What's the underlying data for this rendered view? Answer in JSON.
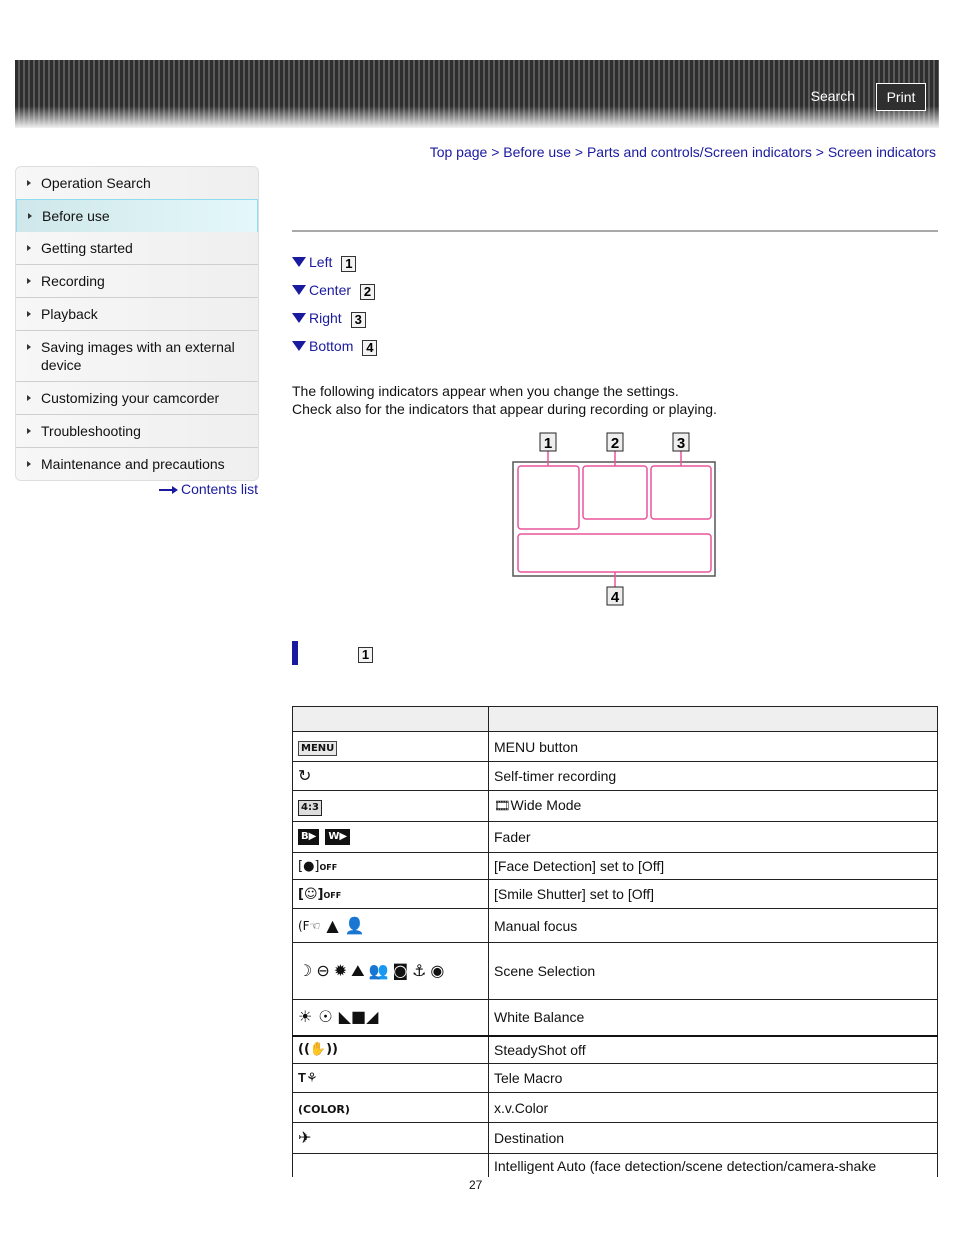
{
  "header": {
    "search_label": "Search",
    "print_label": "Print"
  },
  "sidebar": {
    "items": [
      {
        "label": "Operation Search",
        "active": false
      },
      {
        "label": "Before use",
        "active": true
      },
      {
        "label": "Getting started",
        "active": false
      },
      {
        "label": "Recording",
        "active": false
      },
      {
        "label": "Playback",
        "active": false
      },
      {
        "label": "Saving images with an external device",
        "active": false
      },
      {
        "label": "Customizing your camcorder",
        "active": false
      },
      {
        "label": "Troubleshooting",
        "active": false
      },
      {
        "label": "Maintenance and precautions",
        "active": false
      }
    ],
    "contents_link": "Contents list"
  },
  "breadcrumb": {
    "items": [
      "Top page",
      "Before use",
      "Parts and controls/Screen indicators",
      "Screen indicators"
    ],
    "separator": ">"
  },
  "anchors": [
    {
      "label": "Left",
      "num": "1"
    },
    {
      "label": "Center",
      "num": "2"
    },
    {
      "label": "Right",
      "num": "3"
    },
    {
      "label": "Bottom",
      "num": "4"
    }
  ],
  "intro": {
    "line1": "The following indicators appear when you change the settings.",
    "line2": "Check also for the indicators that appear during recording or playing."
  },
  "diagram": {
    "labels": [
      "1",
      "2",
      "3",
      "4"
    ],
    "accent_color": "#e8559c"
  },
  "section": {
    "num": "1"
  },
  "table": {
    "headers": [
      "",
      ""
    ],
    "rows": [
      {
        "icon": "menu-icon",
        "icon_text": "MENU",
        "desc": "MENU button"
      },
      {
        "icon": "self-timer-icon",
        "icon_text": "",
        "desc": "Self-timer recording"
      },
      {
        "icon": "aspect-4-3-icon",
        "icon_text": "4:3",
        "desc": "Wide Mode",
        "desc_prefix_icon": "film-icon"
      },
      {
        "icon": "fader-icons",
        "icon_text": "B▶ W▶",
        "desc": "Fader"
      },
      {
        "icon": "face-detection-off-icon",
        "icon_text": "OFF",
        "desc": "[Face Detection] set to [Off]"
      },
      {
        "icon": "smile-shutter-off-icon",
        "icon_text": "OFF",
        "desc": "[Smile Shutter] set to [Off]"
      },
      {
        "icon": "manual-focus-icons",
        "icon_text": "",
        "desc": "Manual focus"
      },
      {
        "icon": "scene-selection-icons",
        "icon_text": "",
        "desc": "Scene Selection"
      },
      {
        "icon": "white-balance-icons",
        "icon_text": "",
        "desc": "White Balance"
      },
      {
        "icon": "steadyshot-off-icon",
        "icon_text": "",
        "desc": "SteadyShot off"
      },
      {
        "icon": "tele-macro-icon",
        "icon_text": "T",
        "desc": "Tele Macro"
      },
      {
        "icon": "xv-color-icon",
        "icon_text": "(COLOR)",
        "desc": "x.v.Color"
      },
      {
        "icon": "destination-icon",
        "icon_text": "",
        "desc": "Destination"
      },
      {
        "icon": "",
        "icon_text": "",
        "desc": "Intelligent Auto (face detection/scene detection/camera-shake"
      }
    ]
  },
  "page_number": "27"
}
